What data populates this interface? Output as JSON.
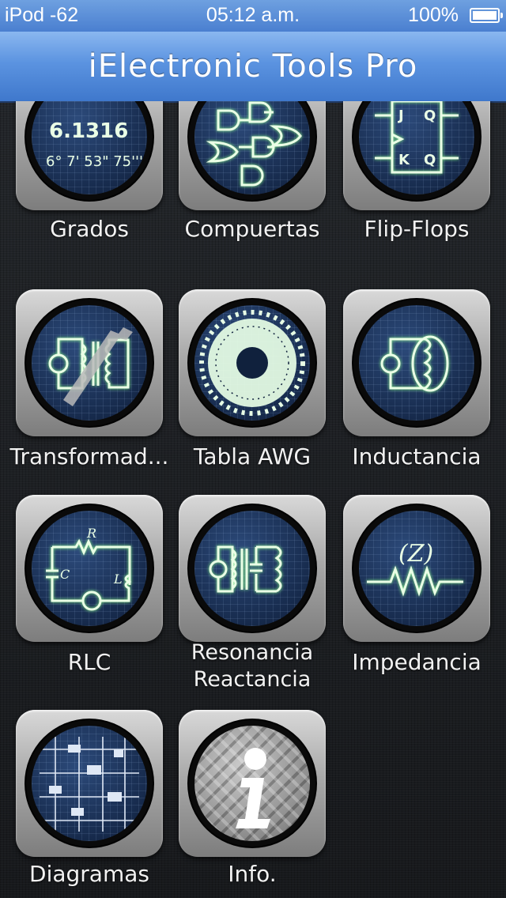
{
  "status_bar": {
    "carrier": "iPod -62",
    "time": "05:12 a.m.",
    "battery": "100%"
  },
  "nav": {
    "title": "iElectronic Tools Pro"
  },
  "tiles": [
    {
      "label": "Grados",
      "icon": "degrees-icon",
      "lines": [
        "6.1316",
        "6° 7' 53\" 75'''"
      ]
    },
    {
      "label": "Compuertas",
      "icon": "logic-gates-icon"
    },
    {
      "label": "Flip-Flops",
      "icon": "flip-flop-icon",
      "lines": [
        "J",
        "Q",
        "K"
      ]
    },
    {
      "label": "Transformad...",
      "icon": "transformer-icon"
    },
    {
      "label": "Tabla AWG",
      "icon": "awg-gauge-icon"
    },
    {
      "label": "Inductancia",
      "icon": "inductor-icon"
    },
    {
      "label": "RLC",
      "icon": "rlc-circuit-icon",
      "lines": [
        "R",
        "C",
        "L"
      ]
    },
    {
      "label": "Resonancia\nReactancia",
      "label_lines": [
        "Resonancia",
        "Reactancia"
      ],
      "icon": "resonance-icon"
    },
    {
      "label": "Impedancia",
      "icon": "impedance-icon",
      "lines": [
        "(Z)"
      ]
    },
    {
      "label": "Diagramas",
      "icon": "diagram-icon"
    },
    {
      "label": "Info.",
      "icon": "info-icon"
    }
  ]
}
